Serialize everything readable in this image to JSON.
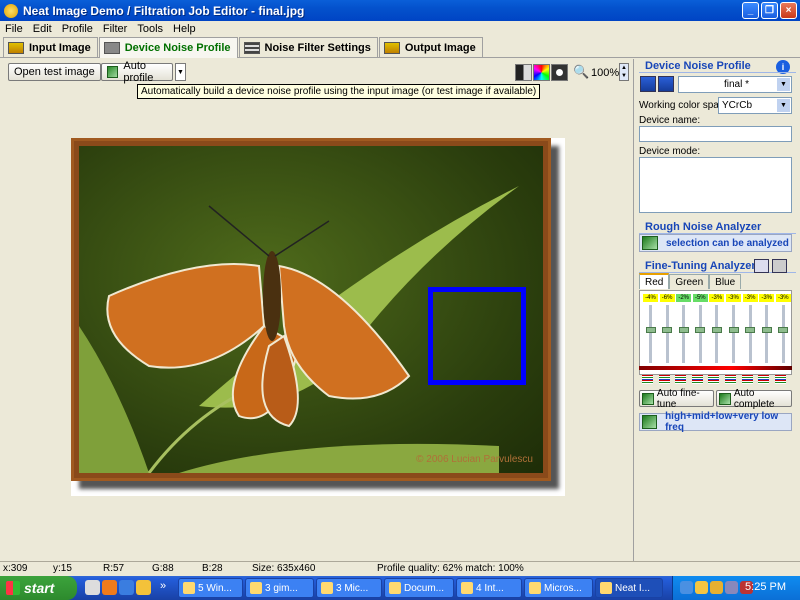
{
  "window": {
    "title": "Neat Image Demo / Filtration Job Editor - final.jpg",
    "min": "_",
    "max": "❐",
    "close": "×"
  },
  "menu": [
    "File",
    "Edit",
    "Profile",
    "Filter",
    "Tools",
    "Help"
  ],
  "tabs": [
    {
      "label": "Input Image",
      "icon": "folder-image-icon"
    },
    {
      "label": "Device Noise Profile",
      "icon": "camera-icon",
      "active": true
    },
    {
      "label": "Noise Filter Settings",
      "icon": "filter-settings-icon"
    },
    {
      "label": "Output Image",
      "icon": "output-image-icon"
    }
  ],
  "toolbar": {
    "open_test_image": "Open test image",
    "auto_profile": "Auto profile",
    "dropdown_arrow": "▼",
    "zoom_glyph": "🔍",
    "zoom": "100%",
    "spin_up": "▲",
    "spin_down": "▼",
    "tooltip": "Automatically build a device noise profile using the input image (or test image if available)"
  },
  "image": {
    "copyright": "© 2006 Lucian Parvulescu",
    "selection_color": "#0000ff"
  },
  "panel": {
    "device_noise_profile": {
      "title": "Device Noise Profile",
      "info": "i",
      "profile_name": "final *",
      "dropdown_arrow": "▼",
      "working_color_space_label": "Working color space:",
      "working_color_space": "YCrCb",
      "device_name_label": "Device name:",
      "device_name": "",
      "device_mode_label": "Device mode:",
      "device_mode": ""
    },
    "rough_noise": {
      "title": "Rough Noise Analyzer",
      "status": "selection can be analyzed"
    },
    "fine_tuning": {
      "title": "Fine-Tuning Analyzer",
      "channels": [
        "Red",
        "Green",
        "Blue"
      ],
      "active_channel": "Red",
      "adjustments": [
        "-4%",
        "-6%",
        "-2%",
        "-5%",
        "-3%",
        "-3%",
        "-3%",
        "-3%",
        "-3%"
      ],
      "adjustment_colors": [
        "#ffff00",
        "#ffff00",
        "#66dd66",
        "#66dd66",
        "#ffff00",
        "#ffff00",
        "#ffff00",
        "#ffff00",
        "#ffff00"
      ],
      "auto_fine_tune": "Auto fine-tune",
      "auto_complete": "Auto complete",
      "freq_status": "high+mid+low+very low freq"
    }
  },
  "statusbar": {
    "x": "x:309",
    "y": "y:15",
    "r": "R:57",
    "g": "G:88",
    "b": "B:28",
    "size": "Size: 635x460",
    "quality": "Profile quality: 62%  match: 100%"
  },
  "taskbar": {
    "start": "start",
    "chevron": "»",
    "tasks": [
      {
        "label": "5 Win...",
        "icon": "folder-icon"
      },
      {
        "label": "3 gim...",
        "icon": "gimp-icon"
      },
      {
        "label": "3 Mic...",
        "icon": "office-icon"
      },
      {
        "label": "Docum...",
        "icon": "word-icon"
      },
      {
        "label": "4 Int...",
        "icon": "ie-icon"
      },
      {
        "label": "Micros...",
        "icon": "excel-icon"
      },
      {
        "label": "Neat I...",
        "icon": "neat-image-icon",
        "active": true
      }
    ],
    "clock": "5:25 PM"
  }
}
